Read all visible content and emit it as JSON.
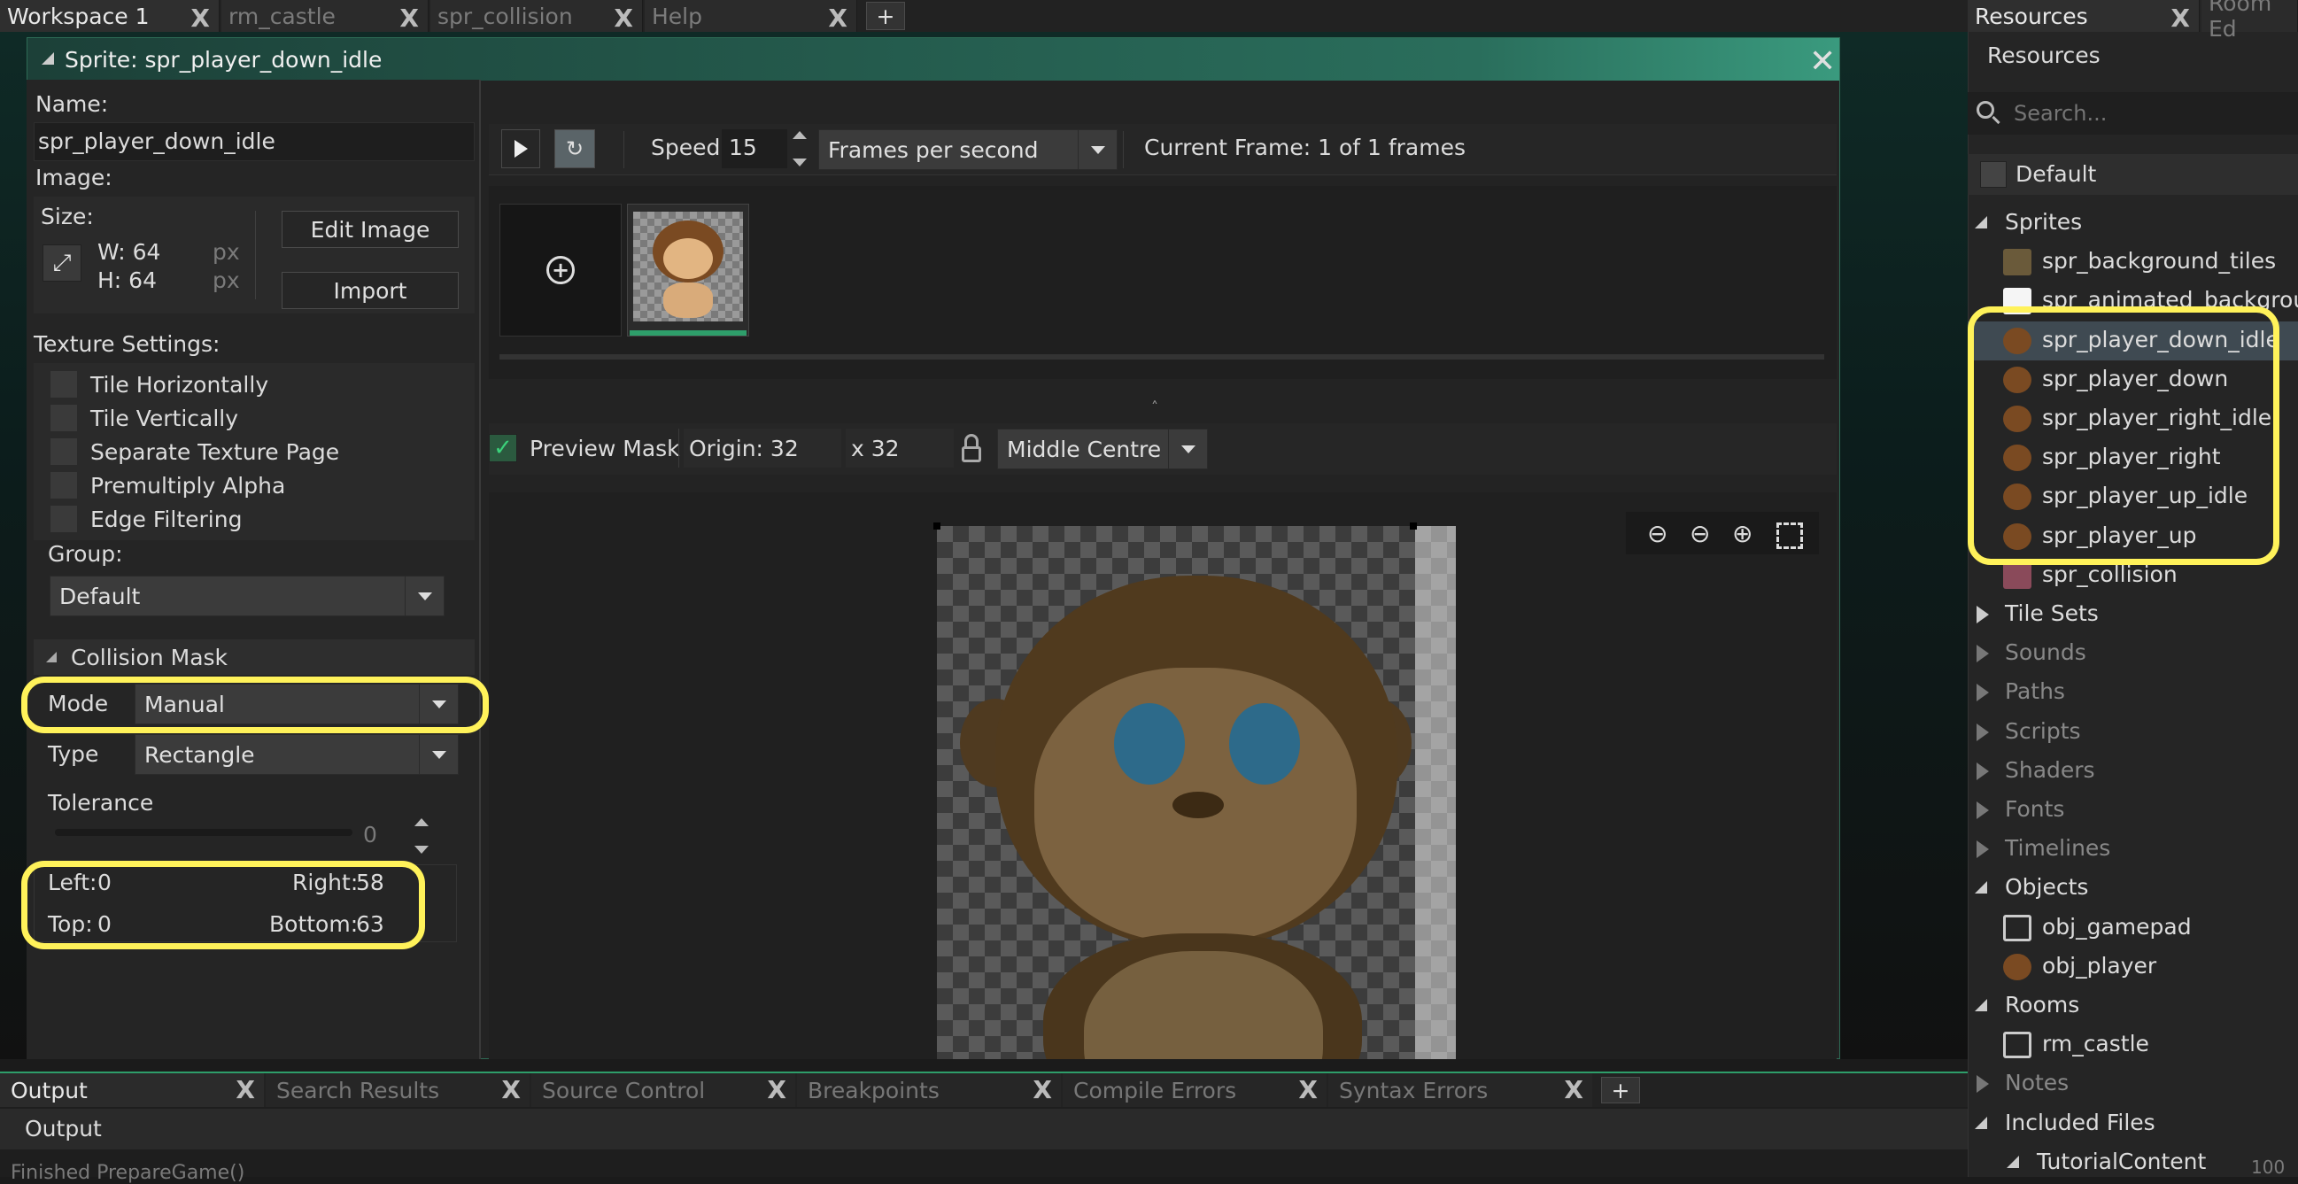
{
  "workspace_tabs": [
    {
      "label": "Workspace 1",
      "active": true
    },
    {
      "label": "rm_castle",
      "active": false
    },
    {
      "label": "spr_collision",
      "active": false
    },
    {
      "label": "Help",
      "active": false
    }
  ],
  "add_tab": "+",
  "close_glyph": "X",
  "sprite_window": {
    "title": "Sprite: spr_player_down_idle",
    "name_label": "Name:",
    "name_value": "spr_player_down_idle",
    "image_label": "Image:",
    "size_label": "Size:",
    "width": "W: 64",
    "height": "H: 64",
    "px": "px",
    "edit_image": "Edit Image",
    "import": "Import",
    "texture_settings": "Texture Settings:",
    "checkboxes": [
      "Tile Horizontally",
      "Tile Vertically",
      "Separate Texture Page",
      "Premultiply Alpha",
      "Edge Filtering"
    ],
    "group_label": "Group:",
    "group_value": "Default",
    "collision_mask": "Collision Mask",
    "mode_label": "Mode",
    "mode_value": "Manual",
    "type_label": "Type",
    "type_value": "Rectangle",
    "tolerance_label": "Tolerance",
    "tolerance_value": "0",
    "left": "Left:",
    "left_value": "0",
    "right": "Right:",
    "right_value": "58",
    "top": "Top:",
    "top_value": "0",
    "bottom": "Bottom:",
    "bottom_value": "63"
  },
  "playback": {
    "speed_label": "Speed:",
    "speed_value": "15",
    "speed_unit": "Frames per second",
    "current_frame": "Current Frame: 1 of 1 frames"
  },
  "origin_bar": {
    "preview_mask": "Preview Mask",
    "origin_label": "Origin: 32",
    "origin_y": "x 32",
    "origin_preset": "Middle Centre"
  },
  "resources": {
    "tabs": [
      "Resources",
      "Room Ed"
    ],
    "header": "Resources",
    "search_placeholder": "Search...",
    "filter": "Default",
    "tree": [
      {
        "label": "Sprites",
        "kind": "folder",
        "open": true
      },
      {
        "label": "spr_background_tiles",
        "kind": "item"
      },
      {
        "label": "spr_animated_background",
        "kind": "item"
      },
      {
        "label": "spr_player_down_idle",
        "kind": "item",
        "selected": true
      },
      {
        "label": "spr_player_down",
        "kind": "item"
      },
      {
        "label": "spr_player_right_idle",
        "kind": "item"
      },
      {
        "label": "spr_player_right",
        "kind": "item"
      },
      {
        "label": "spr_player_up_idle",
        "kind": "item"
      },
      {
        "label": "spr_player_up",
        "kind": "item"
      },
      {
        "label": "spr_collision",
        "kind": "item"
      },
      {
        "label": "Tile Sets",
        "kind": "folder",
        "open": false
      },
      {
        "label": "Sounds",
        "kind": "folder",
        "open": false,
        "empty": true
      },
      {
        "label": "Paths",
        "kind": "folder",
        "open": false,
        "empty": true
      },
      {
        "label": "Scripts",
        "kind": "folder",
        "open": false,
        "empty": true
      },
      {
        "label": "Shaders",
        "kind": "folder",
        "open": false,
        "empty": true
      },
      {
        "label": "Fonts",
        "kind": "folder",
        "open": false,
        "empty": true
      },
      {
        "label": "Timelines",
        "kind": "folder",
        "open": false,
        "empty": true
      },
      {
        "label": "Objects",
        "kind": "folder",
        "open": true
      },
      {
        "label": "obj_gamepad",
        "kind": "item"
      },
      {
        "label": "obj_player",
        "kind": "item"
      },
      {
        "label": "Rooms",
        "kind": "folder",
        "open": true
      },
      {
        "label": "rm_castle",
        "kind": "item"
      },
      {
        "label": "Notes",
        "kind": "folder",
        "open": false,
        "empty": true
      },
      {
        "label": "Included Files",
        "kind": "folder",
        "open": true
      },
      {
        "label": "TutorialContent",
        "kind": "subfolder"
      }
    ],
    "zoom": "100"
  },
  "output_tabs": [
    "Output",
    "Search Results",
    "Source Control",
    "Breakpoints",
    "Compile Errors",
    "Syntax Errors"
  ],
  "output": {
    "header": "Output",
    "line1": "Finished PrepareGame()"
  },
  "colors": {
    "highlight": "#fff25a",
    "accent": "#2e9e6a"
  }
}
